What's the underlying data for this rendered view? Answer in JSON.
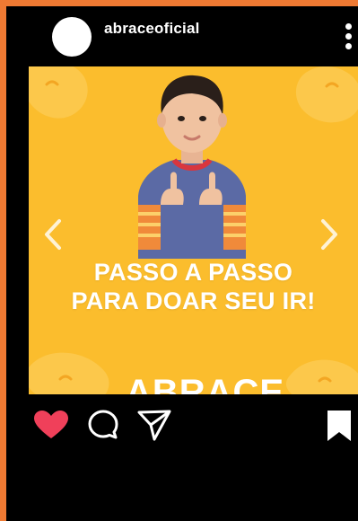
{
  "header": {
    "username": "abraceoficial"
  },
  "post": {
    "headline_line1": "PASSO A PASSO",
    "headline_line2": "PARA DOAR SEU IR!",
    "brand": "ABRACE",
    "background_color": "#fbbd2d"
  },
  "actions": {
    "like_icon": "heart-icon",
    "comment_icon": "comment-icon",
    "share_icon": "send-icon",
    "save_icon": "bookmark-icon",
    "like_color": "#f0405a"
  },
  "colors": {
    "frame": "#ef7a33",
    "app_bg": "#000000",
    "post_bg": "#fbbd2d"
  }
}
